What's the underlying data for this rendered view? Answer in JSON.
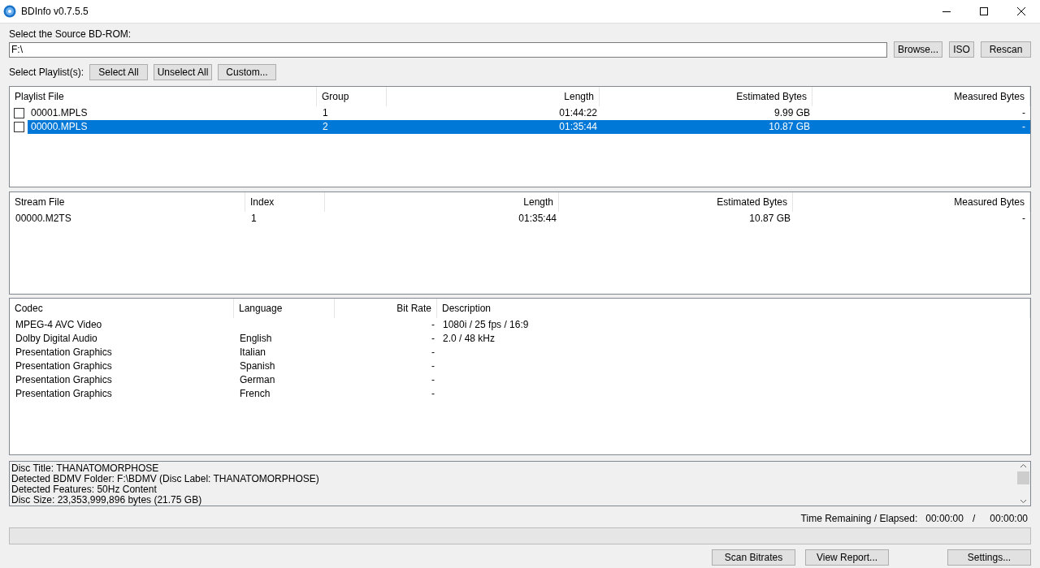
{
  "window": {
    "title": "BDInfo v0.7.5.5"
  },
  "source": {
    "label": "Select the Source BD-ROM:",
    "value": "F:\\",
    "buttons": [
      "Browse...",
      "ISO",
      "Rescan"
    ]
  },
  "playlist_select": {
    "label": "Select Playlist(s):",
    "buttons": [
      "Select All",
      "Unselect All",
      "Custom..."
    ]
  },
  "playlists": {
    "columns": [
      "Playlist File",
      "Group",
      "Length",
      "Estimated Bytes",
      "Measured Bytes"
    ],
    "rows": [
      {
        "cells": [
          "00001.MPLS",
          "1",
          "01:44:22",
          "9.99 GB",
          "-"
        ],
        "checked": false,
        "selected": false
      },
      {
        "cells": [
          "00000.MPLS",
          "2",
          "01:35:44",
          "10.87 GB",
          "-"
        ],
        "checked": false,
        "selected": true
      }
    ]
  },
  "streams": {
    "columns": [
      "Stream File",
      "Index",
      "Length",
      "Estimated Bytes",
      "Measured Bytes"
    ],
    "rows": [
      {
        "cells": [
          "00000.M2TS",
          "1",
          "01:35:44",
          "10.87 GB",
          "-"
        ]
      }
    ]
  },
  "codecs": {
    "columns": [
      "Codec",
      "Language",
      "Bit Rate",
      "Description"
    ],
    "rows": [
      {
        "cells": [
          "MPEG-4 AVC Video",
          "",
          "-",
          "1080i / 25 fps / 16:9"
        ]
      },
      {
        "cells": [
          "Dolby Digital Audio",
          "English",
          "-",
          "2.0 / 48 kHz"
        ]
      },
      {
        "cells": [
          "Presentation Graphics",
          "Italian",
          "-",
          ""
        ]
      },
      {
        "cells": [
          "Presentation Graphics",
          "Spanish",
          "-",
          ""
        ]
      },
      {
        "cells": [
          "Presentation Graphics",
          "German",
          "-",
          ""
        ]
      },
      {
        "cells": [
          "Presentation Graphics",
          "French",
          "-",
          ""
        ]
      }
    ]
  },
  "info": [
    "Disc Title: THANATOMORPHOSE",
    "Detected BDMV Folder: F:\\BDMV (Disc Label: THANATOMORPHOSE)",
    "Detected Features: 50Hz Content",
    "Disc Size: 23,353,999,896 bytes (21.75 GB)"
  ],
  "time": {
    "label": "Time Remaining / Elapsed:",
    "remaining": "00:00:00",
    "separator": "/",
    "elapsed": "00:00:00"
  },
  "progress": {
    "level": 0
  },
  "bottom_buttons": [
    "Scan Bitrates",
    "View Report...",
    "Settings..."
  ]
}
